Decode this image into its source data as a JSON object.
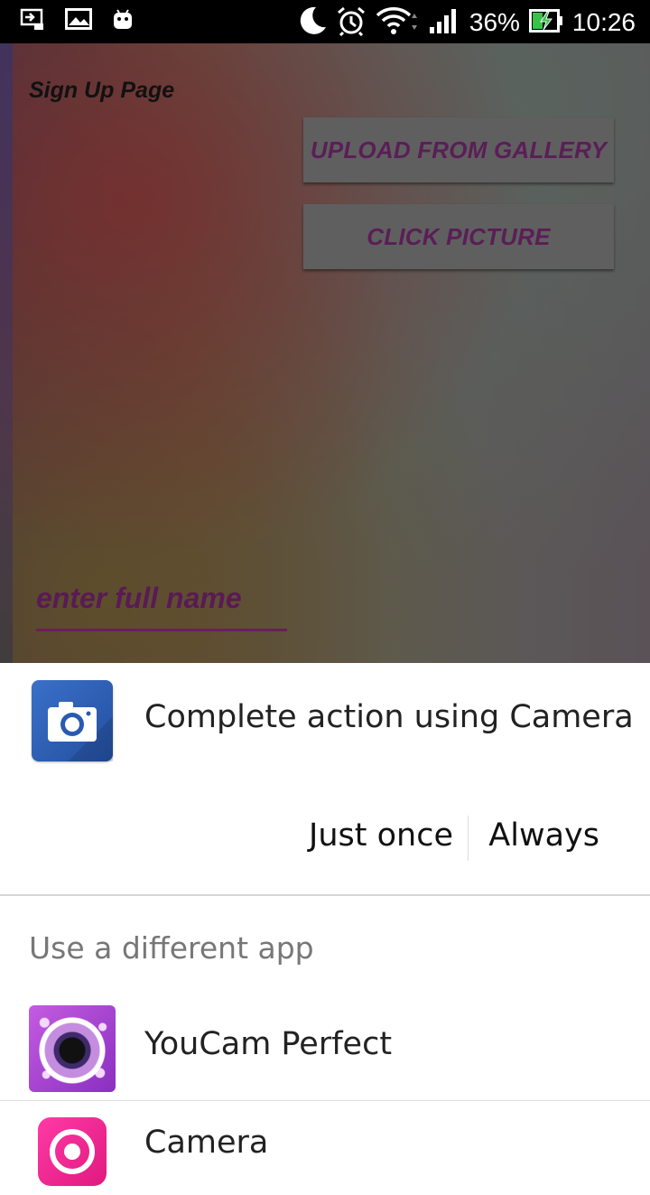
{
  "status_bar": {
    "battery_percent": "36%",
    "time": "10:26",
    "icons": [
      "screen-cast-icon",
      "gallery-icon",
      "android-icon",
      "moon-icon",
      "alarm-icon",
      "wifi-icon",
      "signal-icon",
      "battery-charging-icon"
    ]
  },
  "app": {
    "title": "Sign Up Page",
    "upload_button": "UPLOAD FROM GALLERY",
    "click_button": "CLICK PICTURE",
    "name_placeholder": "enter full name"
  },
  "chooser": {
    "default_app_title": "Complete action using Camera",
    "just_once": "Just once",
    "always": "Always",
    "different_app_label": "Use a different app",
    "apps": [
      {
        "label": "YouCam Perfect",
        "icon": "youcam-perfect-icon"
      },
      {
        "label": "Camera",
        "icon": "camera-app-icon"
      }
    ]
  },
  "colors": {
    "accent": "#5a1e57",
    "dialog_bg": "#ffffff",
    "status_bar": "#000000"
  }
}
